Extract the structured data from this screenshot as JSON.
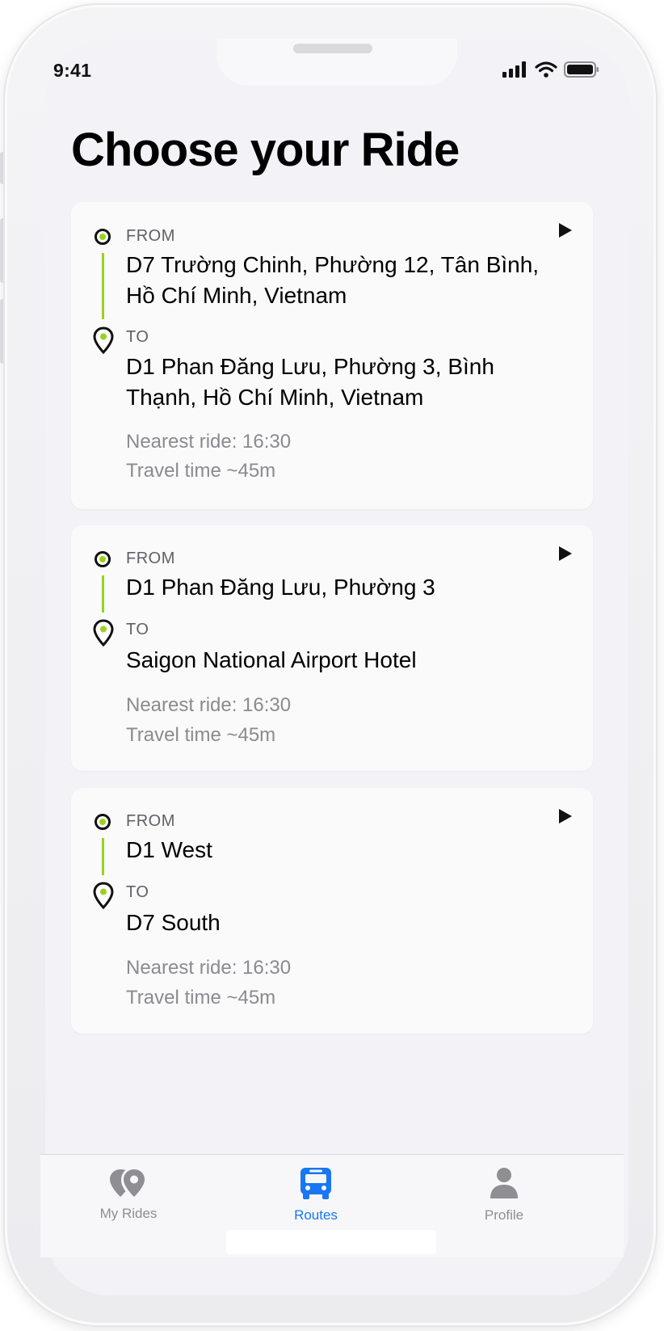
{
  "status_bar": {
    "time": "9:41"
  },
  "page": {
    "title": "Choose your Ride"
  },
  "rides": [
    {
      "from_label": "FROM",
      "from": "D7 Trường Chinh, Phường 12, Tân Bình, Hồ Chí Minh, Vietnam",
      "to_label": "TO",
      "to": "D1 Phan Đăng Lưu, Phường 3, Bình Thạnh, Hồ Chí Minh, Vietnam",
      "nearest": "Nearest ride: 16:30",
      "travel": "Travel time ~45m"
    },
    {
      "from_label": "FROM",
      "from": "D1 Phan Đăng Lưu, Phường 3",
      "to_label": "TO",
      "to": "Saigon National Airport Hotel",
      "nearest": "Nearest ride: 16:30",
      "travel": "Travel time ~45m"
    },
    {
      "from_label": "FROM",
      "from": "D1 West",
      "to_label": "TO",
      "to": "D7 South",
      "nearest": "Nearest ride: 16:30",
      "travel": "Travel time ~45m"
    }
  ],
  "tabs": [
    {
      "label": "My Rides",
      "icon": "my-rides-icon",
      "active": false
    },
    {
      "label": "Routes",
      "icon": "bus-icon",
      "active": true
    },
    {
      "label": "Profile",
      "icon": "person-icon",
      "active": false
    }
  ],
  "colors": {
    "accent_green": "#9ad21b",
    "active_tab": "#1877f2",
    "inactive_tab": "#8e8e93",
    "screen_bg": "#f2f2f7",
    "card_bg": "#fafafa"
  }
}
